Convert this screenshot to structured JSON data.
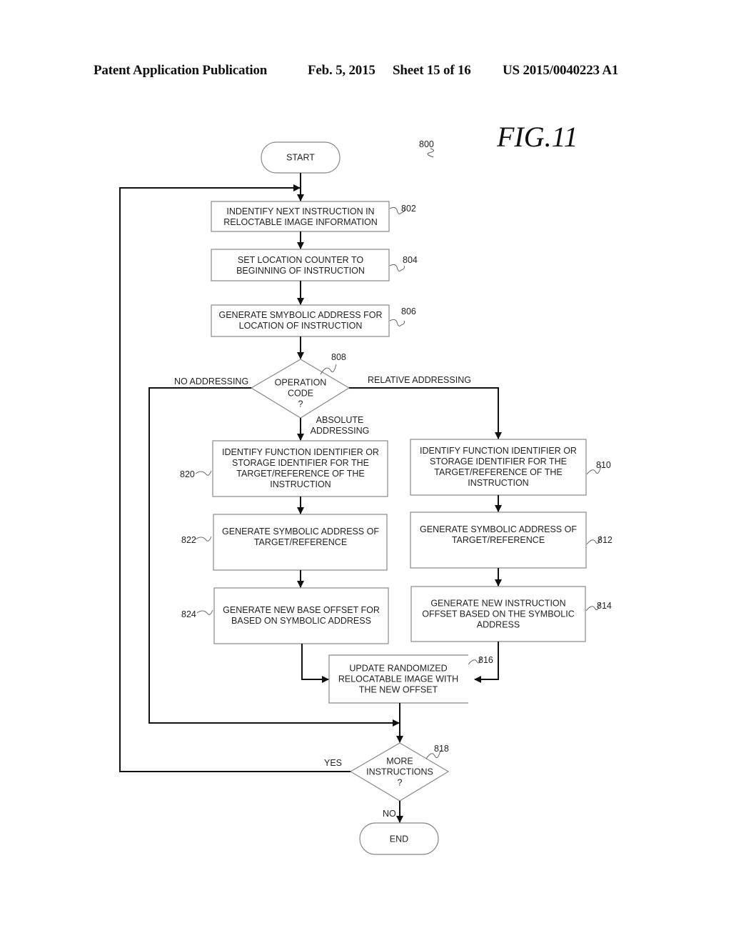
{
  "header": {
    "publication": "Patent Application Publication",
    "date": "Feb. 5, 2015",
    "sheet": "Sheet 15 of 16",
    "number": "US 2015/0040223 A1"
  },
  "figure": {
    "title": "FIG.11",
    "ref": "800"
  },
  "nodes": {
    "start": {
      "lines": [
        "START"
      ]
    },
    "n802": {
      "ref": "802",
      "lines": [
        "INDENTIFY NEXT INSTRUCTION IN",
        "RELOCTABLE IMAGE INFORMATION"
      ]
    },
    "n804": {
      "ref": "804",
      "lines": [
        "SET LOCATION COUNTER TO",
        "BEGINNING OF INSTRUCTION"
      ]
    },
    "n806": {
      "ref": "806",
      "lines": [
        "GENERATE SMYBOLIC ADDRESS FOR",
        "LOCATION OF INSTRUCTION"
      ]
    },
    "n808": {
      "ref": "808",
      "lines": [
        "OPERATION",
        "CODE",
        "?"
      ]
    },
    "n820": {
      "ref": "820",
      "lines": [
        "IDENTIFY FUNCTION IDENTIFIER OR",
        "STORAGE IDENTIFIER FOR THE",
        "TARGET/REFERENCE OF THE",
        "INSTRUCTION"
      ]
    },
    "n822": {
      "ref": "822",
      "lines": [
        "GENERATE SYMBOLIC ADDRESS OF",
        "TARGET/REFERENCE"
      ]
    },
    "n824": {
      "ref": "824",
      "lines": [
        "GENERATE NEW BASE OFFSET FOR",
        "BASED ON SYMBOLIC ADDRESS"
      ]
    },
    "n810": {
      "ref": "810",
      "lines": [
        "IDENTIFY FUNCTION IDENTIFIER OR",
        "STORAGE IDENTIFIER FOR THE",
        "TARGET/REFERENCE OF THE",
        "INSTRUCTION"
      ]
    },
    "n812": {
      "ref": "812",
      "lines": [
        "GENERATE SYMBOLIC ADDRESS OF",
        "TARGET/REFERENCE"
      ]
    },
    "n814": {
      "ref": "814",
      "lines": [
        "GENERATE NEW INSTRUCTION",
        "OFFSET BASED ON THE SYMBOLIC",
        "ADDRESS"
      ]
    },
    "n816": {
      "ref": "816",
      "lines": [
        "UPDATE RANDOMIZED",
        "RELOCATABLE IMAGE WITH",
        "THE NEW OFFSET"
      ]
    },
    "n818": {
      "ref": "818",
      "lines": [
        "MORE",
        "INSTRUCTIONS",
        "?"
      ]
    },
    "end": {
      "lines": [
        "END"
      ]
    }
  },
  "edge_labels": {
    "no_addressing": "NO ADDRESSING",
    "relative_addressing": "RELATIVE ADDRESSING",
    "absolute_addressing": [
      "ABSOLUTE",
      "ADDRESSING"
    ],
    "yes": "YES",
    "no": "NO"
  }
}
